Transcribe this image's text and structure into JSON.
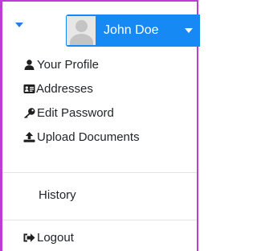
{
  "toggle": {
    "icon": "caret-down-icon"
  },
  "user": {
    "name": "John Doe",
    "avatar_icon": "default-avatar-icon",
    "caret_icon": "caret-down-icon"
  },
  "menu": {
    "items": [
      {
        "label": "Your Profile",
        "icon": "user-icon"
      },
      {
        "label": "Addresses",
        "icon": "address-card-icon"
      },
      {
        "label": "Edit Password",
        "icon": "key-icon"
      },
      {
        "label": "Upload Documents",
        "icon": "upload-icon"
      },
      {
        "label": "History",
        "icon": ""
      },
      {
        "label": "Logout",
        "icon": "sign-out-icon"
      }
    ]
  },
  "colors": {
    "accent": "#1789f4",
    "frame": "#c13bd6",
    "text": "#212529",
    "divider": "#e3e3e3"
  }
}
